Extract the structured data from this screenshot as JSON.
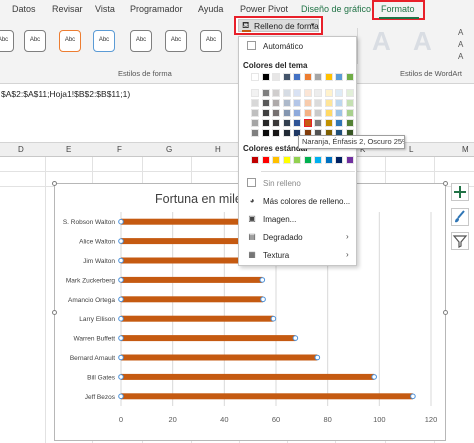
{
  "ribbon": {
    "tabs": [
      "Datos",
      "Revisar",
      "Vista",
      "Programador",
      "Ayuda",
      "Power Pivot",
      "Diseño de gráfico",
      "Formato"
    ],
    "active_tab": "Formato",
    "shape_style_label": "Abc",
    "shape_style_colors": [
      "#7f7f7f",
      "#7f7f7f",
      "#ed7d31",
      "#5b9bd5",
      "#7f7f7f",
      "#7f7f7f",
      "#7f7f7f"
    ],
    "group_shape_styles": "Estilos de forma",
    "group_wordart": "Estilos de WordArt",
    "wordart_letter": "A",
    "wordart_side": [
      "A",
      "A",
      "A"
    ]
  },
  "fill_button": {
    "label": "Relleno de forma",
    "current_color": "#c55a11"
  },
  "fill_menu": {
    "automatic": "Automático",
    "theme_colors_label": "Colores del tema",
    "standard_colors_label": "Colores estándar",
    "no_fill": "Sin relleno",
    "more_colors": "Más colores de relleno...",
    "picture": "Imagen...",
    "gradient": "Degradado",
    "texture": "Textura",
    "tooltip": "Naranja, Énfasis 2, Oscuro 25%",
    "theme_top_row": [
      "#ffffff",
      "#000000",
      "#e7e6e6",
      "#44546a",
      "#4472c4",
      "#ed7d31",
      "#a5a5a5",
      "#ffc000",
      "#5b9bd5",
      "#70ad47"
    ],
    "theme_shades": [
      [
        "#f2f2f2",
        "#7f7f7f",
        "#d0cece",
        "#d6dce4",
        "#d9e2f3",
        "#fbe5d5",
        "#ededed",
        "#fff2cc",
        "#deebf6",
        "#e2efd9"
      ],
      [
        "#d8d8d8",
        "#595959",
        "#aeaaaa",
        "#adb9ca",
        "#b4c6e7",
        "#f7cbac",
        "#dbdbdb",
        "#fee599",
        "#bdd7ee",
        "#c5e0b3"
      ],
      [
        "#bfbfbf",
        "#3f3f3f",
        "#757070",
        "#8496b0",
        "#8eaadb",
        "#f4b183",
        "#c9c9c9",
        "#ffd965",
        "#9cc3e5",
        "#a8d08d"
      ],
      [
        "#a5a5a5",
        "#262626",
        "#3a3838",
        "#323f4f",
        "#2f5496",
        "#c55a11",
        "#7b7b7b",
        "#bf9000",
        "#2e75b5",
        "#538135"
      ],
      [
        "#7f7f7f",
        "#0c0c0c",
        "#171616",
        "#222a35",
        "#1f3864",
        "#833c0b",
        "#525252",
        "#7f6000",
        "#1e4e79",
        "#375623"
      ]
    ],
    "standard": [
      "#c00000",
      "#ff0000",
      "#ffc000",
      "#ffff00",
      "#92d050",
      "#00b050",
      "#00b0f0",
      "#0070c0",
      "#002060",
      "#7030a0"
    ]
  },
  "formula_bar": {
    "text": "$A$2:$A$11;Hoja1!$B$2:$B$11;1)"
  },
  "columns": [
    "D",
    "E",
    "F",
    "G",
    "H",
    "I",
    "J",
    "K",
    "L",
    "M"
  ],
  "chart_data": {
    "type": "bar",
    "title": "Fortuna en miles",
    "categories": [
      "Jeff Bezos",
      "Bill Gates",
      "Bernard Arnault",
      "Warren Buffett",
      "Larry Ellison",
      "Amancio Ortega",
      "Mark Zuckerberg",
      "Jim Walton",
      "Alice Walton",
      "S. Robson Walton"
    ],
    "values": [
      113,
      98,
      76,
      67.5,
      59,
      55,
      54.7,
      54.6,
      54.4,
      54.1
    ],
    "xlim": [
      0,
      120
    ],
    "xticks": [
      0,
      20,
      40,
      60,
      80,
      100,
      120
    ],
    "bar_color": "#c55a11",
    "grid": true,
    "legend": "none"
  }
}
